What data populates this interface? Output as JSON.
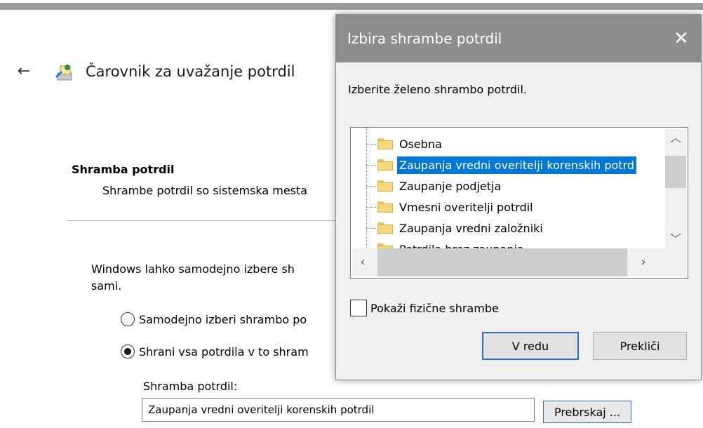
{
  "wizard": {
    "title": "Čarovnik za uvažanje potrdil",
    "section_title": "Shramba potrdil",
    "section_desc": "Shrambe potrdil so sistemska mesta",
    "intro_line1": "Windows lahko samodejno izbere sh",
    "intro_line2": "sami.",
    "radio_auto": "Samodejno izberi shrambo po",
    "radio_manual": "Shrani vsa potrdila v to shram",
    "store_label": "Shramba potrdil:",
    "store_value": "Zaupanja vredni overitelji korenskih potrdil",
    "browse_label": "Prebrskaj ..."
  },
  "dialog": {
    "title": "Izbira shrambe potrdil",
    "close_glyph": "✕",
    "prompt": "Izberite želeno shrambo potrdil.",
    "tree_items": [
      {
        "label": "Osebna",
        "selected": false
      },
      {
        "label": "Zaupanja vredni overitelji korenskih potrd",
        "selected": true
      },
      {
        "label": "Zaupanje podjetja",
        "selected": false
      },
      {
        "label": "Vmesni overitelji potrdil",
        "selected": false
      },
      {
        "label": "Zaupanja vredni založniki",
        "selected": false
      },
      {
        "label": "Potrdila brez zaupanja",
        "selected": false
      }
    ],
    "show_physical_label": "Pokaži fizične shrambe",
    "ok_label": "V redu",
    "cancel_label": "Prekliči"
  },
  "icons": {
    "back": "back-arrow-icon",
    "wizard": "certificate-import-icon",
    "folder": "folder-icon"
  },
  "colors": {
    "selection": "#0078d7",
    "accent_border": "#2a6fc9",
    "titlebar": "#8d8d8d"
  }
}
